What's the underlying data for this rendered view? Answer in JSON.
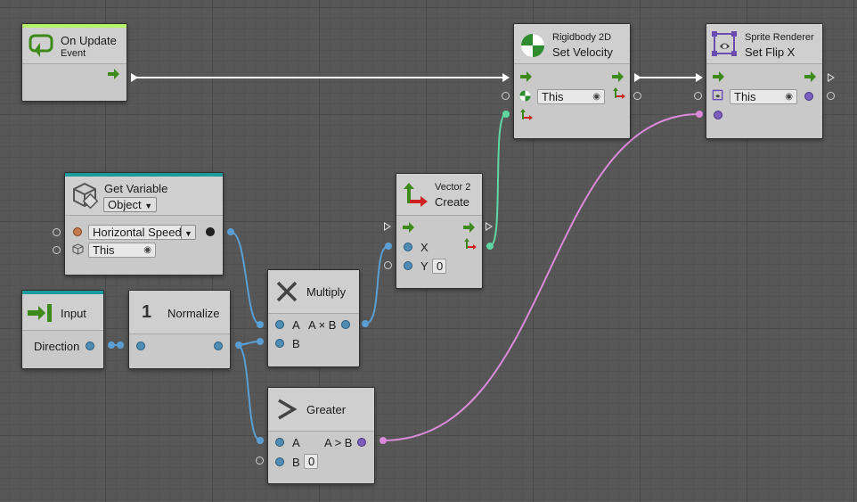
{
  "nodes": {
    "on_update": {
      "title": "On Update",
      "subtitle": "Event"
    },
    "get_variable": {
      "title": "Get Variable",
      "kind": "Object",
      "name": "Horizontal Speed",
      "target": "This"
    },
    "input": {
      "title": "Input",
      "port_label": "Direction"
    },
    "normalize": {
      "number": "1",
      "title": "Normalize"
    },
    "multiply": {
      "title": "Multiply",
      "in_a": "A",
      "in_b": "B",
      "out": "A × B"
    },
    "greater": {
      "title": "Greater",
      "in_a": "A",
      "in_b": "B",
      "out": "A > B",
      "b_value": "0"
    },
    "vector2": {
      "category": "Vector 2",
      "title": "Create",
      "in_x": "X",
      "in_y": "Y",
      "y_value": "0"
    },
    "rigidbody": {
      "category": "Rigidbody 2D",
      "title": "Set Velocity",
      "target": "This"
    },
    "sprite": {
      "category": "Sprite Renderer",
      "title": "Set Flip X",
      "target": "This"
    }
  },
  "colors": {
    "float_wire": "#5b9fd2",
    "vector_wire": "#5fd7a4",
    "bool_wire": "#d98ad8",
    "control_wire": "#ffffff",
    "event_band": "#b6f26a",
    "teal_band": "#1b9b9b",
    "flow_arrow": "#3d8a1a"
  },
  "icons": [
    "on-update-icon",
    "get-variable-icon",
    "input-icon",
    "multiply-icon",
    "greater-icon",
    "vector2-icon",
    "rigidbody-icon",
    "sprite-renderer-icon"
  ]
}
